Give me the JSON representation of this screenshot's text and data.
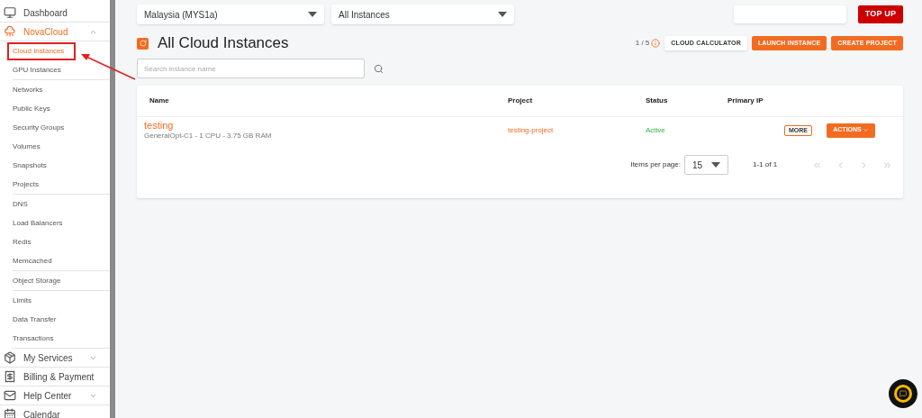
{
  "sidebar": {
    "sections": [
      {
        "label": "Dashboard",
        "kind": "monitor",
        "active": false
      },
      {
        "label": "NovaCloud",
        "kind": "cloud",
        "expanded": true,
        "active": true,
        "groups": [
          [
            {
              "label": "Cloud Instances",
              "selected": true
            },
            {
              "label": "GPU Instances",
              "selected": false
            }
          ],
          [
            {
              "label": "Networks",
              "selected": false
            },
            {
              "label": "Public Keys",
              "selected": false
            },
            {
              "label": "Security Groups",
              "selected": false
            },
            {
              "label": "Volumes",
              "selected": false
            },
            {
              "label": "Snapshots",
              "selected": false
            },
            {
              "label": "Projects",
              "selected": false
            }
          ],
          [
            {
              "label": "DNS",
              "selected": false
            },
            {
              "label": "Load Balancers",
              "selected": false
            },
            {
              "label": "Redis",
              "selected": false
            },
            {
              "label": "Memcached",
              "selected": false
            }
          ],
          [
            {
              "label": "Object Storage",
              "selected": false
            }
          ],
          [
            {
              "label": "Limits",
              "selected": false
            },
            {
              "label": "Data Transfer",
              "selected": false
            },
            {
              "label": "Transactions",
              "selected": false
            }
          ]
        ]
      },
      {
        "label": "My Services",
        "kind": "box",
        "expanded": false,
        "active": false
      },
      {
        "label": "Billing & Payment",
        "kind": "bill",
        "active": false
      },
      {
        "label": "Help Center",
        "kind": "mail",
        "expanded": false,
        "active": false
      },
      {
        "label": "Calendar",
        "kind": "calendar",
        "active": false
      }
    ]
  },
  "topbar": {
    "region": "Malaysia (MYS1a)",
    "filter": "All Instances",
    "top_up": "TOP UP"
  },
  "header": {
    "title": "All Cloud Instances",
    "quota": "1 / 5",
    "buttons": [
      {
        "label": "CLOUD CALCULATOR",
        "kind": "outline"
      },
      {
        "label": "LAUNCH INSTANCE",
        "kind": "primary"
      },
      {
        "label": "CREATE PROJECT",
        "kind": "primary"
      }
    ]
  },
  "search": {
    "placeholder": "Search instance name"
  },
  "table": {
    "columns": [
      "Name",
      "Project",
      "Status",
      "Primary IP"
    ],
    "rows": [
      {
        "name": "testing",
        "spec": "GeneralOpt-C1 - 1 CPU - 3.75 GB RAM",
        "project": "testing-project",
        "status": "Active",
        "more": "MORE",
        "actions": "ACTIONS"
      }
    ]
  },
  "pager": {
    "label": "Items per page:",
    "page_size": "15",
    "range": "1-1 of 1"
  }
}
